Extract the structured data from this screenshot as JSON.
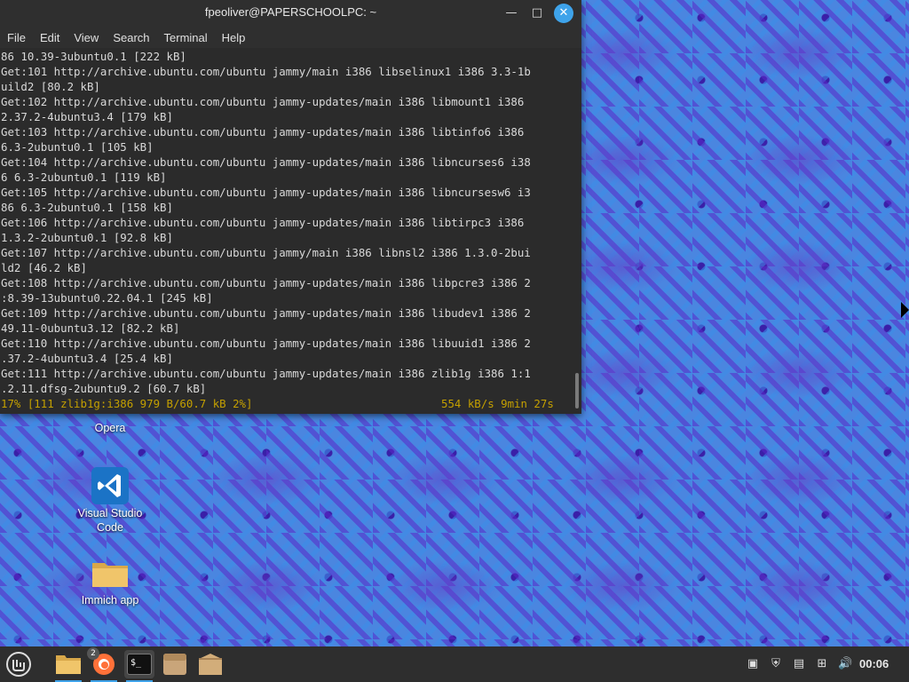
{
  "window": {
    "title": "fpeoliver@PAPERSCHOOLPC: ~",
    "minimize_glyph": "—",
    "maximize_glyph": "□",
    "close_glyph": "✕"
  },
  "menu": [
    "File",
    "Edit",
    "View",
    "Search",
    "Terminal",
    "Help"
  ],
  "terminal_lines": [
    "86 10.39-3ubuntu0.1 [222 kB]",
    "Get:101 http://archive.ubuntu.com/ubuntu jammy/main i386 libselinux1 i386 3.3-1b",
    "uild2 [80.2 kB]",
    "Get:102 http://archive.ubuntu.com/ubuntu jammy-updates/main i386 libmount1 i386",
    "2.37.2-4ubuntu3.4 [179 kB]",
    "Get:103 http://archive.ubuntu.com/ubuntu jammy-updates/main i386 libtinfo6 i386",
    "6.3-2ubuntu0.1 [105 kB]",
    "Get:104 http://archive.ubuntu.com/ubuntu jammy-updates/main i386 libncurses6 i38",
    "6 6.3-2ubuntu0.1 [119 kB]",
    "Get:105 http://archive.ubuntu.com/ubuntu jammy-updates/main i386 libncursesw6 i3",
    "86 6.3-2ubuntu0.1 [158 kB]",
    "Get:106 http://archive.ubuntu.com/ubuntu jammy-updates/main i386 libtirpc3 i386",
    "1.3.2-2ubuntu0.1 [92.8 kB]",
    "Get:107 http://archive.ubuntu.com/ubuntu jammy/main i386 libnsl2 i386 1.3.0-2bui",
    "ld2 [46.2 kB]",
    "Get:108 http://archive.ubuntu.com/ubuntu jammy-updates/main i386 libpcre3 i386 2",
    ":8.39-13ubuntu0.22.04.1 [245 kB]",
    "Get:109 http://archive.ubuntu.com/ubuntu jammy-updates/main i386 libudev1 i386 2",
    "49.11-0ubuntu3.12 [82.2 kB]",
    "Get:110 http://archive.ubuntu.com/ubuntu jammy-updates/main i386 libuuid1 i386 2",
    ".37.2-4ubuntu3.4 [25.4 kB]",
    "Get:111 http://archive.ubuntu.com/ubuntu jammy-updates/main i386 zlib1g i386 1:1",
    ".2.11.dfsg-2ubuntu9.2 [60.7 kB]"
  ],
  "status": {
    "progress": "17% [111 zlib1g:i386 979 B/60.7 kB 2%]",
    "rate": "554 kB/s 9min 27s"
  },
  "desktop_icons": [
    {
      "label": "Opera",
      "icon": "opera-icon"
    },
    {
      "label": "Visual Studio Code",
      "icon": "vscode-icon"
    },
    {
      "label": "Immich app",
      "icon": "folder-icon"
    }
  ],
  "taskbar": {
    "items": [
      {
        "icon": "mint-menu-icon"
      },
      {
        "icon": "files-icon"
      },
      {
        "icon": "firefox-icon",
        "badge": "2"
      },
      {
        "icon": "terminal-icon"
      },
      {
        "icon": "archive-icon"
      },
      {
        "icon": "package-icon"
      }
    ],
    "terminal_glyph": "$_",
    "clock": "00:06",
    "tray": [
      "clipboard-icon",
      "shield-icon",
      "update-icon",
      "network-icon",
      "volume-icon"
    ]
  },
  "colors": {
    "accent": "#3ea3ea",
    "status_text": "#c4a000",
    "terminal_bg": "#2b2b2b"
  }
}
